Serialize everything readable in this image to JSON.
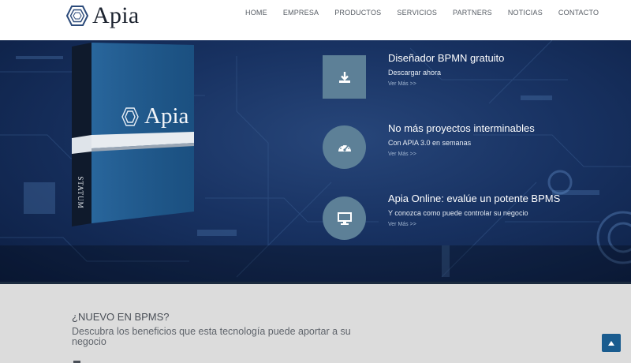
{
  "brand": {
    "name": "Apia",
    "logo_icon": "hexagon-logo-icon"
  },
  "nav": {
    "items": [
      {
        "label": "HOME"
      },
      {
        "label": "EMPRESA"
      },
      {
        "label": "PRODUCTOS"
      },
      {
        "label": "SERVICIOS"
      },
      {
        "label": "PARTNERS"
      },
      {
        "label": "NOTICIAS"
      },
      {
        "label": "CONTACTO"
      }
    ]
  },
  "hero": {
    "product_box": {
      "brand": "Apia",
      "spine_label": "STATUM"
    },
    "features": [
      {
        "icon": "download-icon",
        "title": "Diseñador BPMN gratuito",
        "subtitle": "Descargar ahora",
        "more": "Ver Más >>"
      },
      {
        "icon": "speedometer-icon",
        "title": "No más proyectos interminables",
        "subtitle": "Con APIA 3.0 en semanas",
        "more": "Ver Más >>"
      },
      {
        "icon": "monitor-icon",
        "title": "Apia Online: evalúe un potente BPMS",
        "subtitle": "Y conozca como puede controlar su negocio",
        "more": "Ver Más >>"
      }
    ]
  },
  "intro": {
    "title": "¿NUEVO EN BPMS?",
    "text": "Descubra los beneficios que esta tecnología puede aportar a su negocio"
  },
  "colors": {
    "accent": "#5d8097",
    "scroll_button": "#1a5c8f",
    "hero_dark": "#0c1e42"
  }
}
